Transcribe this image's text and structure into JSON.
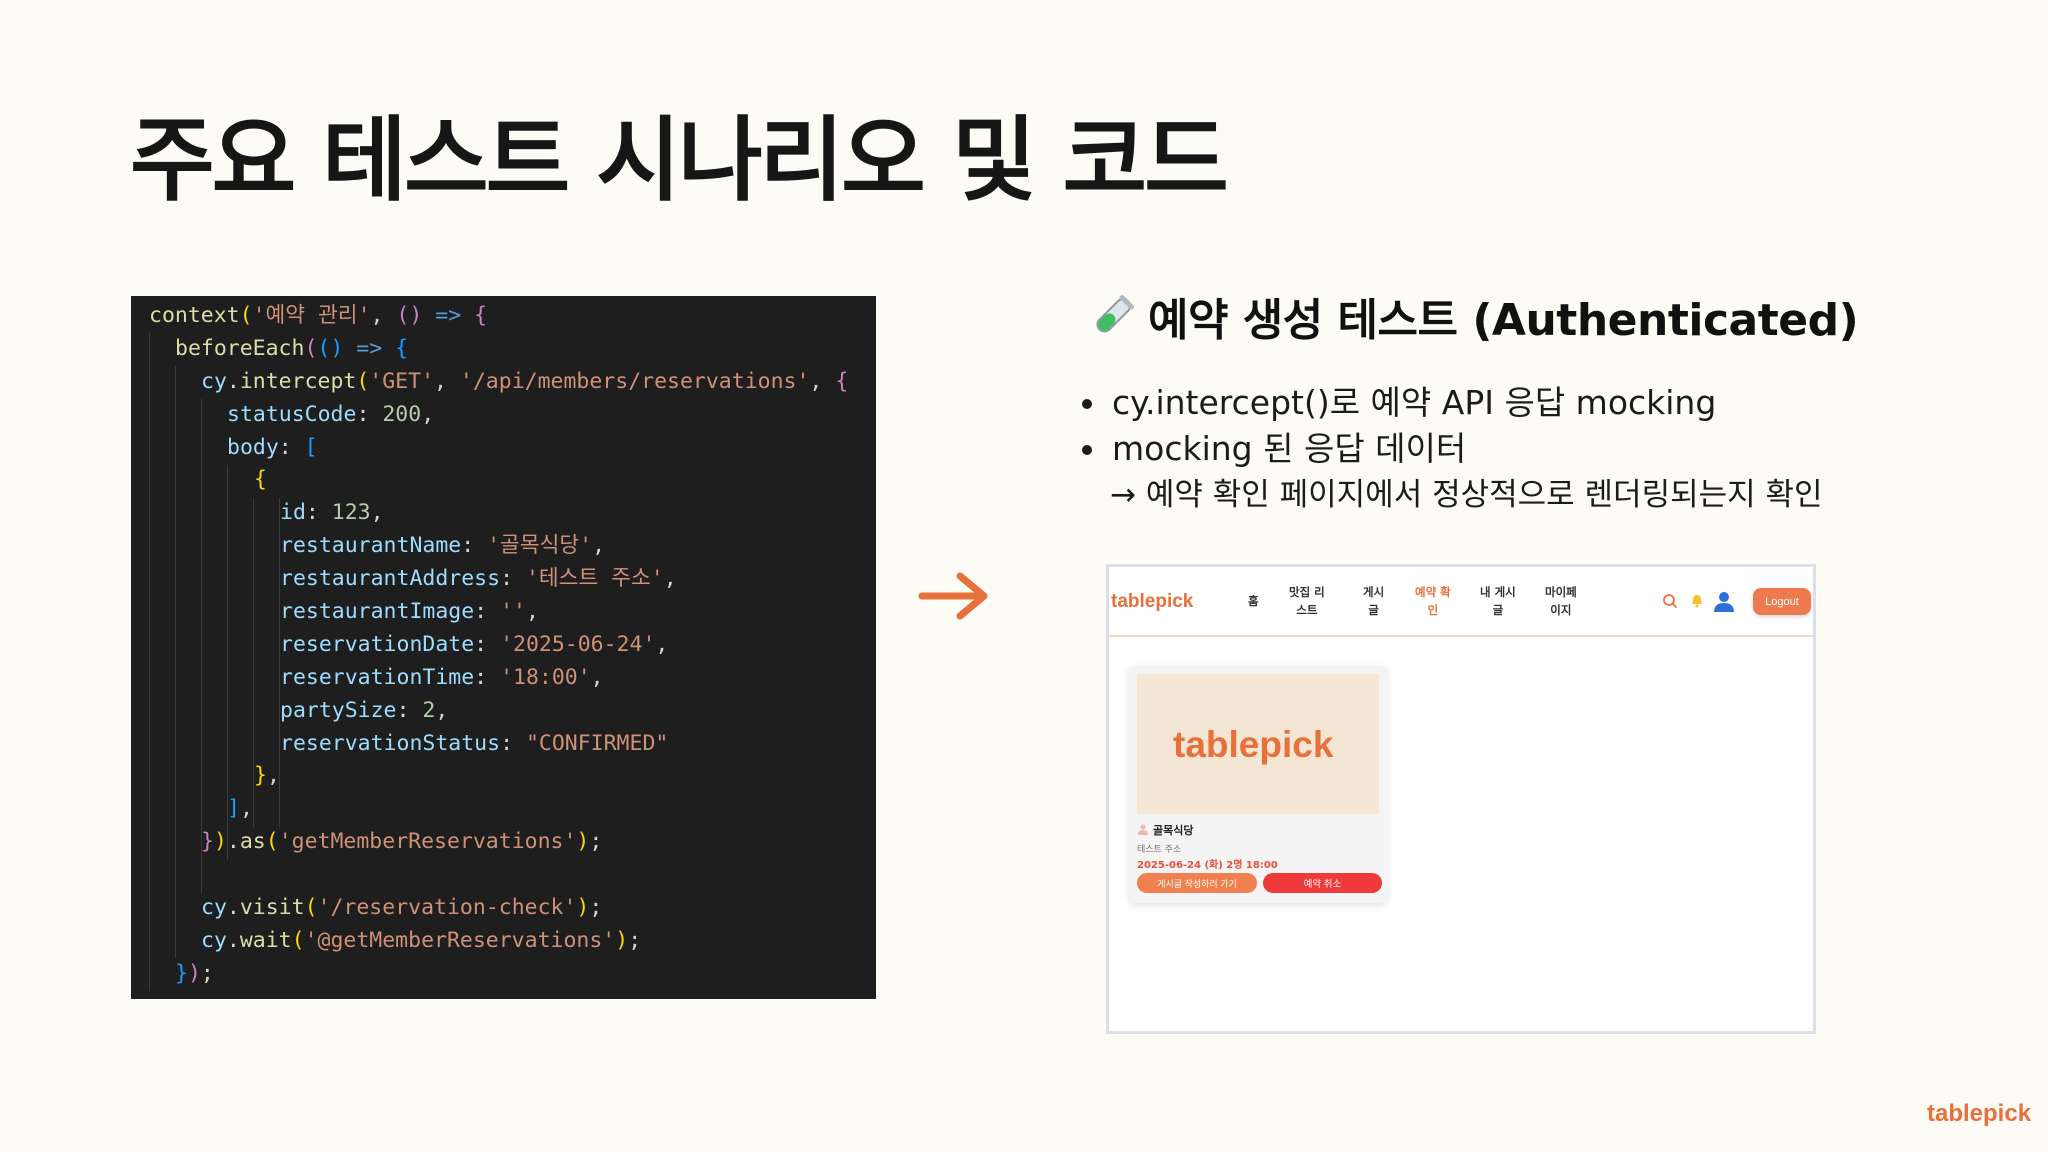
{
  "slide": {
    "title": "주요 테스트 시나리오 및 코드",
    "brand": "tablepick",
    "accent_color": "#e8703a"
  },
  "code": {
    "lines": [
      "context('예약 관리', () => {",
      "beforeEach(() => {",
      "cy.intercept('GET', '/api/members/reservations', {",
      "statusCode: 200,",
      "body: [",
      "{",
      "id: 123,",
      "restaurantName: '골목식당',",
      "restaurantAddress: '테스트 주소',",
      "restaurantImage: '',",
      "reservationDate: '2025-06-24',",
      "reservationTime: '18:00',",
      "partySize: 2,",
      "reservationStatus: \"CONFIRMED\"",
      "},",
      "],",
      "}).as('getMemberReservations');",
      "",
      "cy.visit('/reservation-check');",
      "cy.wait('@getMemberReservations');",
      "});"
    ],
    "theme": "dark"
  },
  "arrow_icon": "right-arrow-icon",
  "section": {
    "icon": "test-tube-icon",
    "title": "예약 생성 테스트 (Authenticated)",
    "bullets": [
      "cy.intercept()로 예약 API 응답 mocking",
      "mocking 된 응답 데이터"
    ],
    "sub_note": "→ 예약 확인 페이지에서 정상적으로 렌더링되는지 확인"
  },
  "mock": {
    "logo": "tablepick",
    "nav": [
      {
        "line1": "홈",
        "line2": ""
      },
      {
        "line1": "맛집 리",
        "line2": "스트"
      },
      {
        "line1": "게시",
        "line2": "글"
      },
      {
        "line1": "예약 확",
        "line2": "인"
      },
      {
        "line1": "내 게시",
        "line2": "글"
      },
      {
        "line1": "마이페",
        "line2": "이지"
      }
    ],
    "active_nav": "예약 확인",
    "icons": [
      "search-icon",
      "bell-icon",
      "user-icon"
    ],
    "logout_label": "Logout",
    "card": {
      "image_logo": "tablepick",
      "name": "골목식당",
      "address": "테스트 주소",
      "datetime": "2025-06-24 (화) 2명 18:00",
      "post_button": "게시글 작성하러 가기",
      "cancel_button": "예약 취소"
    }
  }
}
